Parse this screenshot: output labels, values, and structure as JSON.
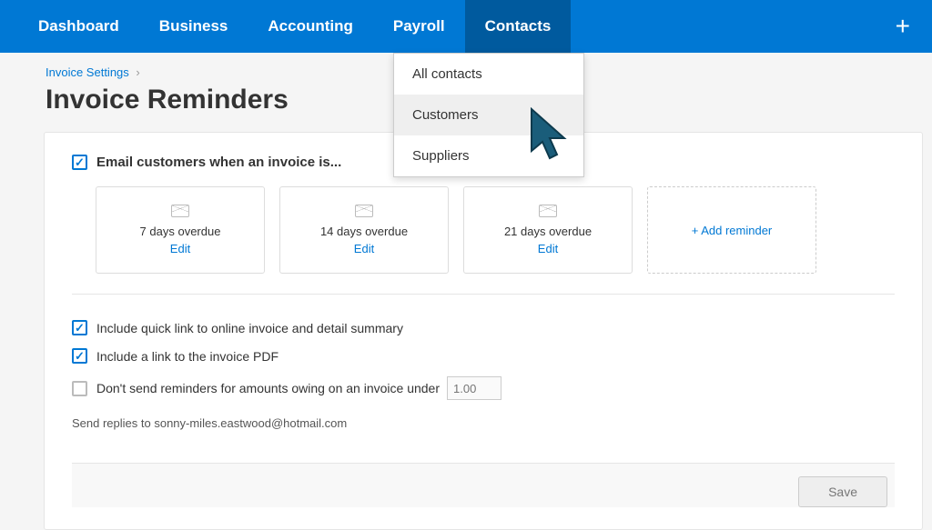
{
  "nav": {
    "items": [
      "Dashboard",
      "Business",
      "Accounting",
      "Payroll",
      "Contacts"
    ],
    "plus": "+"
  },
  "dropdown": {
    "items": [
      "All contacts",
      "Customers",
      "Suppliers"
    ]
  },
  "breadcrumb": {
    "parent": "Invoice Settings",
    "sep": "›"
  },
  "title": "Invoice Reminders",
  "main_check_label": "Email customers when an invoice is...",
  "reminders": [
    {
      "text": "7 days overdue",
      "edit": "Edit"
    },
    {
      "text": "14 days overdue",
      "edit": "Edit"
    },
    {
      "text": "21 days overdue",
      "edit": "Edit"
    }
  ],
  "add_reminder": "+ Add reminder",
  "options": {
    "quicklink": "Include quick link to online invoice and detail summary",
    "pdflink": "Include a link to the invoice PDF",
    "threshold": "Don't send reminders for amounts owing on an invoice under",
    "threshold_placeholder": "1.00"
  },
  "replies": "Send replies to sonny-miles.eastwood@hotmail.com",
  "save": "Save"
}
